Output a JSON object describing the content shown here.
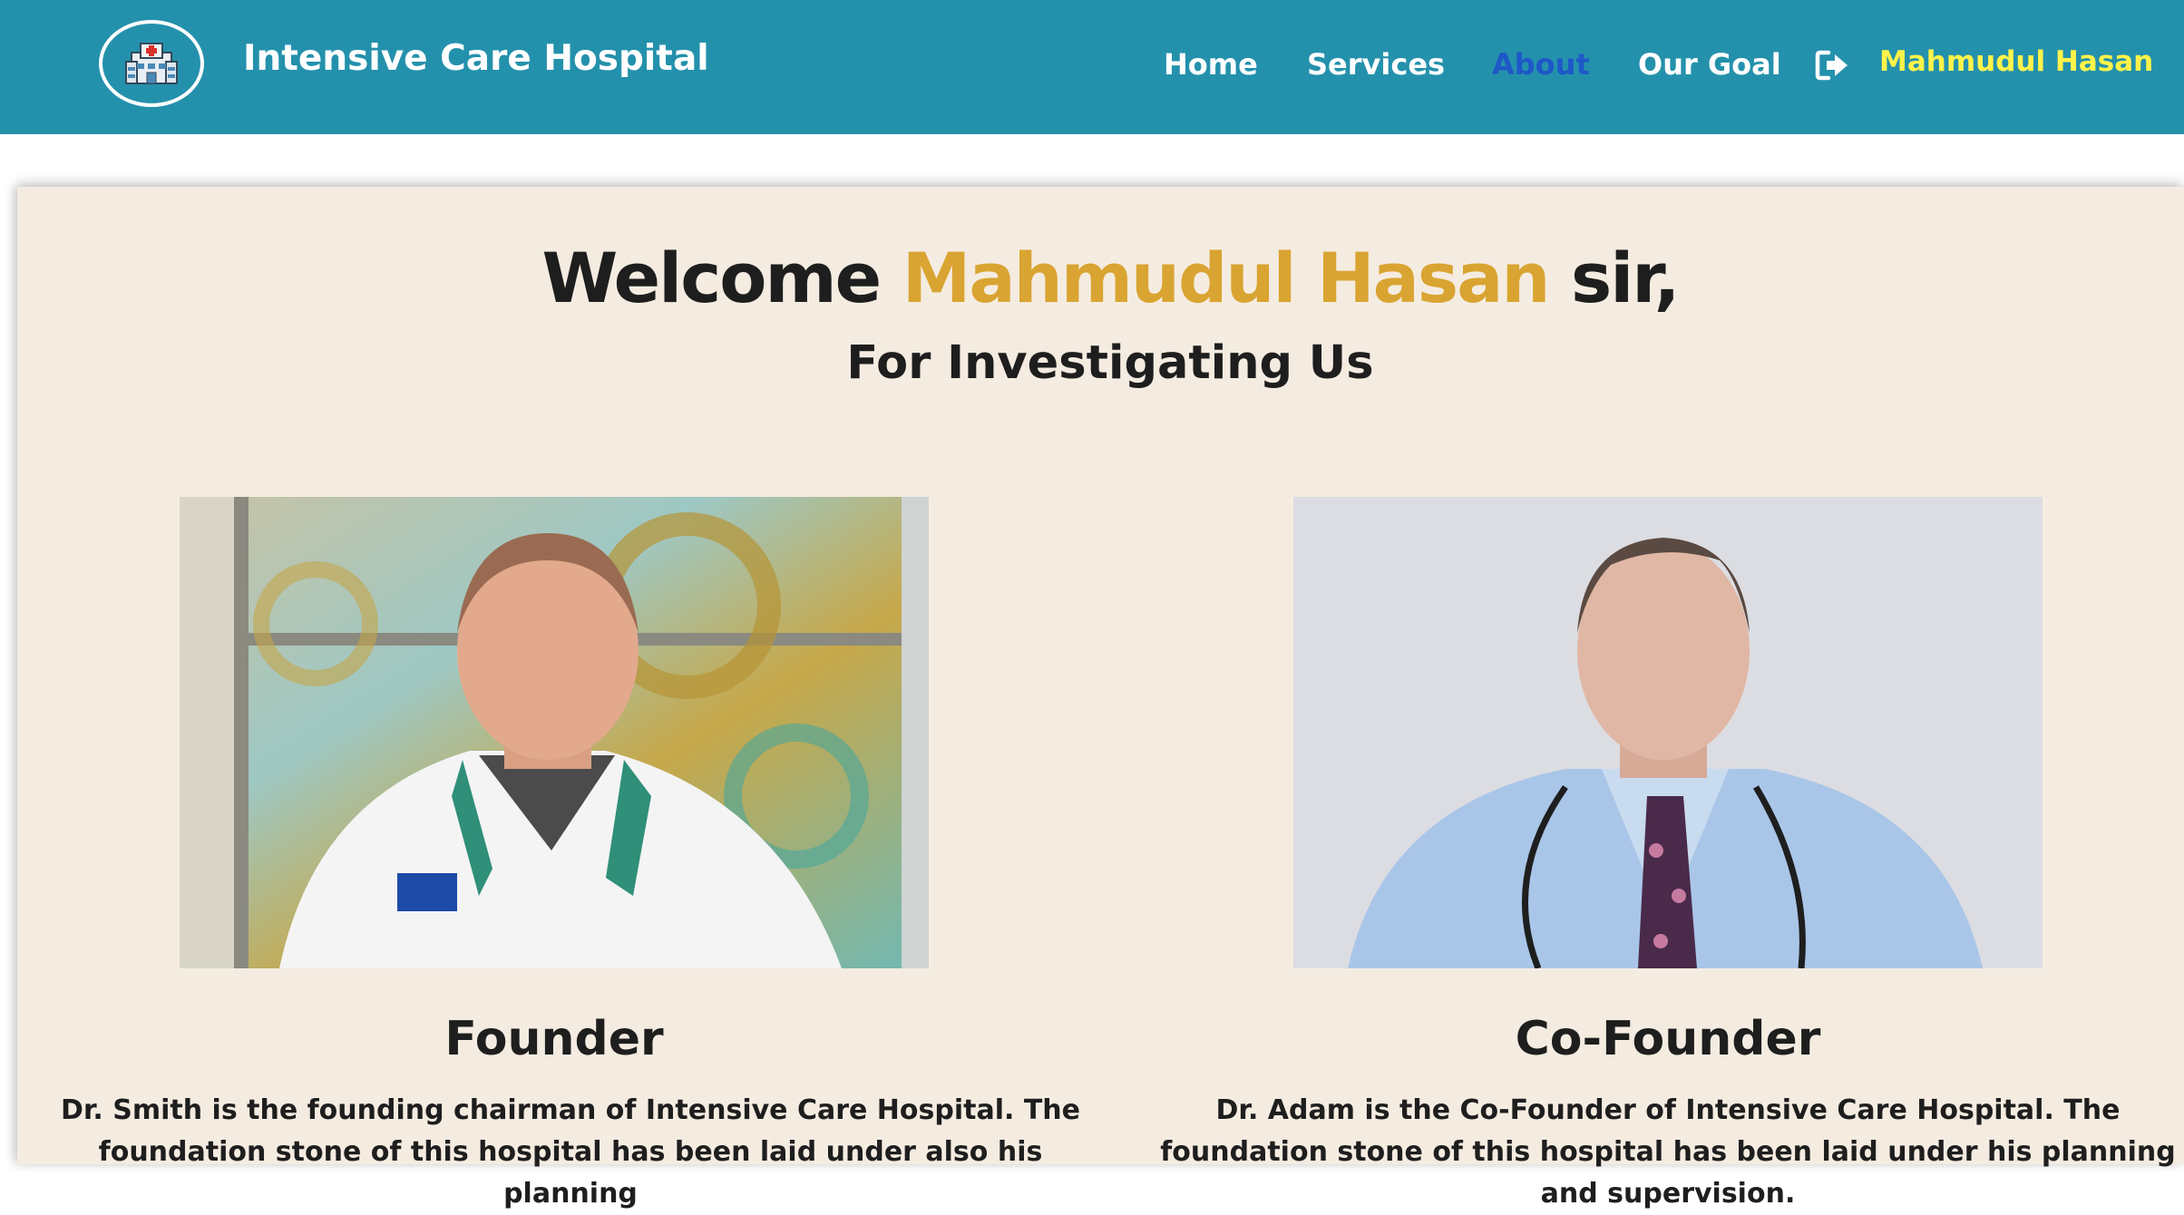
{
  "navbar": {
    "brand": "Intensive Care Hospital",
    "links": [
      "Home",
      "Services",
      "About",
      "Our Goal"
    ],
    "active_link": "About",
    "user_name": "Mahmudul Hasan",
    "logo_icon": "hospital-icon",
    "logout_icon": "sign-out-icon",
    "colors": {
      "bar": "#2491ac",
      "active": "#1e58c8",
      "user": "#fff34a"
    }
  },
  "welcome": {
    "prefix": "Welcome",
    "name": "Mahmudul Hasan",
    "suffix": "sir,",
    "subtitle": "For Investigating Us",
    "highlight_color": "#d9a431"
  },
  "people": [
    {
      "role": "Founder",
      "photo": "founder-photo",
      "description": "Dr. Smith is the founding chairman of Intensive Care Hospital. The foundation stone of this hospital has been laid under also his planning"
    },
    {
      "role": "Co-Founder",
      "photo": "co-founder-photo",
      "description": "Dr. Adam is the Co-Founder of Intensive Care Hospital. The foundation stone of this hospital has been laid under his planning and supervision."
    }
  ]
}
